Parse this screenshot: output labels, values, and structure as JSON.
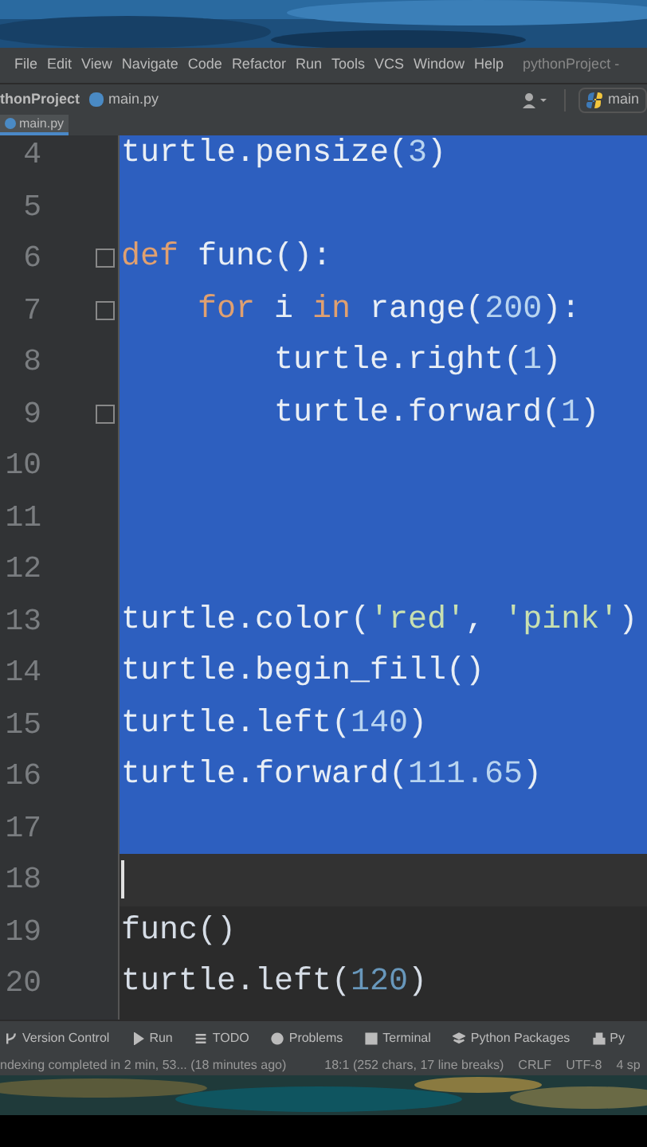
{
  "menu": [
    "File",
    "Edit",
    "View",
    "Navigate",
    "Code",
    "Refactor",
    "Run",
    "Tools",
    "VCS",
    "Window",
    "Help"
  ],
  "window_title": "pythonProject -",
  "breadcrumbs": [
    "thonProject",
    "main.py"
  ],
  "run_config": "main",
  "tabs": [
    {
      "label": "main.py",
      "selected": true
    }
  ],
  "editor": {
    "lines": [
      {
        "number": "4",
        "selected": true,
        "current": false,
        "fold": false,
        "tokens": [
          {
            "text": "turtle.pensize(",
            "kind": "plain"
          },
          {
            "text": "3",
            "kind": "number"
          },
          {
            "text": ")",
            "kind": "plain"
          }
        ]
      },
      {
        "number": "5",
        "selected": true,
        "current": false,
        "fold": false
      },
      {
        "number": "6",
        "selected": true,
        "current": false,
        "fold": true,
        "tokens": [
          {
            "text": "def ",
            "kind": "keyword"
          },
          {
            "text": "func():",
            "kind": "plain"
          }
        ]
      },
      {
        "number": "7",
        "selected": true,
        "current": false,
        "fold": true,
        "tokens": [
          {
            "text": "    for ",
            "kind": "keyword"
          },
          {
            "text": "i ",
            "kind": "plain"
          },
          {
            "text": "in ",
            "kind": "keyword"
          },
          {
            "text": "range(",
            "kind": "plain"
          },
          {
            "text": "200",
            "kind": "number"
          },
          {
            "text": "):",
            "kind": "plain"
          }
        ]
      },
      {
        "number": "8",
        "selected": true,
        "current": false,
        "fold": false,
        "tokens": [
          {
            "text": "        turtle.right(",
            "kind": "plain"
          },
          {
            "text": "1",
            "kind": "number"
          },
          {
            "text": ")",
            "kind": "plain"
          }
        ]
      },
      {
        "number": "9",
        "selected": true,
        "current": false,
        "fold": true,
        "tokens": [
          {
            "text": "        turtle.forward(",
            "kind": "plain"
          },
          {
            "text": "1",
            "kind": "number"
          },
          {
            "text": ")",
            "kind": "plain"
          }
        ]
      },
      {
        "number": "10",
        "selected": true,
        "current": false,
        "fold": false
      },
      {
        "number": "11",
        "selected": true,
        "current": false,
        "fold": false
      },
      {
        "number": "12",
        "selected": true,
        "current": false,
        "fold": false
      },
      {
        "number": "13",
        "selected": true,
        "current": false,
        "fold": false,
        "tokens": [
          {
            "text": "turtle.color(",
            "kind": "plain"
          },
          {
            "text": "'red'",
            "kind": "string"
          },
          {
            "text": ", ",
            "kind": "plain"
          },
          {
            "text": "'pink'",
            "kind": "string"
          },
          {
            "text": ")",
            "kind": "plain"
          }
        ]
      },
      {
        "number": "14",
        "selected": true,
        "current": false,
        "fold": false,
        "tokens": [
          {
            "text": "turtle.begin_fill()",
            "kind": "plain"
          }
        ]
      },
      {
        "number": "15",
        "selected": true,
        "current": false,
        "fold": false,
        "tokens": [
          {
            "text": "turtle.left(",
            "kind": "plain"
          },
          {
            "text": "140",
            "kind": "number"
          },
          {
            "text": ")",
            "kind": "plain"
          }
        ]
      },
      {
        "number": "16",
        "selected": true,
        "current": false,
        "fold": false,
        "tokens": [
          {
            "text": "turtle.forward(",
            "kind": "plain"
          },
          {
            "text": "111.65",
            "kind": "number"
          },
          {
            "text": ")",
            "kind": "plain"
          }
        ]
      },
      {
        "number": "17",
        "selected": true,
        "current": false,
        "fold": false
      },
      {
        "number": "18",
        "selected": false,
        "current": true,
        "fold": false
      },
      {
        "number": "19",
        "selected": false,
        "current": false,
        "fold": false,
        "tokens": [
          {
            "text": "func()",
            "kind": "plain"
          }
        ]
      },
      {
        "number": "20",
        "selected": false,
        "current": false,
        "fold": false,
        "tokens": [
          {
            "text": "turtle.left(",
            "kind": "plain"
          },
          {
            "text": "120",
            "kind": "number"
          },
          {
            "text": ")",
            "kind": "plain"
          }
        ]
      }
    ]
  },
  "tool_windows": [
    {
      "label": "Version Control",
      "kind": "vcs"
    },
    {
      "label": "Run",
      "kind": "run"
    },
    {
      "label": "TODO",
      "kind": "todo"
    },
    {
      "label": "Problems",
      "kind": "problems"
    },
    {
      "label": "Terminal",
      "kind": "terminal"
    },
    {
      "label": "Python Packages",
      "kind": "packages"
    },
    {
      "label": "Py",
      "kind": "console"
    }
  ],
  "status_bar": {
    "message": "ndexing completed in 2 min, 53... (18 minutes ago)",
    "items": [
      "18:1 (252 chars, 17 line breaks)",
      "CRLF",
      "UTF-8",
      "4 sp"
    ]
  }
}
